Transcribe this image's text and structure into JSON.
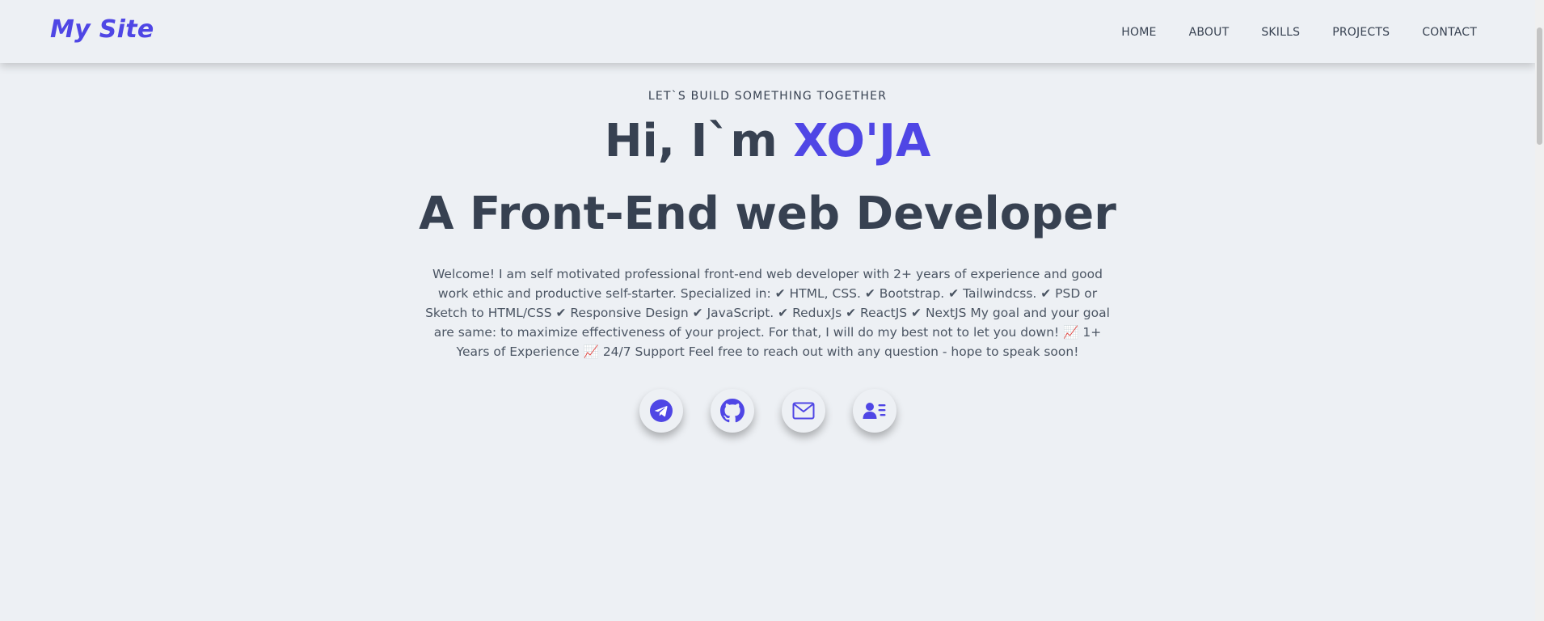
{
  "header": {
    "brand": "My Site",
    "nav": [
      {
        "label": "HOME"
      },
      {
        "label": "ABOUT"
      },
      {
        "label": "SKILLS"
      },
      {
        "label": "PROJECTS"
      },
      {
        "label": "CONTACT"
      }
    ]
  },
  "hero": {
    "tagline": "LET`S BUILD SOMETHING TOGETHER",
    "greeting": "Hi, I`m ",
    "name": "XO'JA",
    "role": "A Front-End web Developer",
    "intro": "Welcome! I am self motivated professional front-end web developer with 2+ years of experience and good work ethic and productive self-starter. Specialized in: ✔ HTML, CSS. ✔ Bootstrap. ✔ Tailwindcss. ✔ PSD or Sketch to HTML/CSS ✔ Responsive Design ✔ JavaScript. ✔ ReduxJs ✔ ReactJS ✔ NextJS My goal and your goal are same: to maximize effectiveness of your project. For that, I will do my best not to let you down! 📈 1+ Years of Experience 📈 24/7 Support Feel free to reach out with any question - hope to speak soon!"
  },
  "social": [
    {
      "icon": "telegram-icon"
    },
    {
      "icon": "github-icon"
    },
    {
      "icon": "mail-icon"
    },
    {
      "icon": "contact-card-icon"
    }
  ],
  "colors": {
    "accent": "#4f46e5",
    "text": "#374151",
    "background": "#edf0f4"
  }
}
